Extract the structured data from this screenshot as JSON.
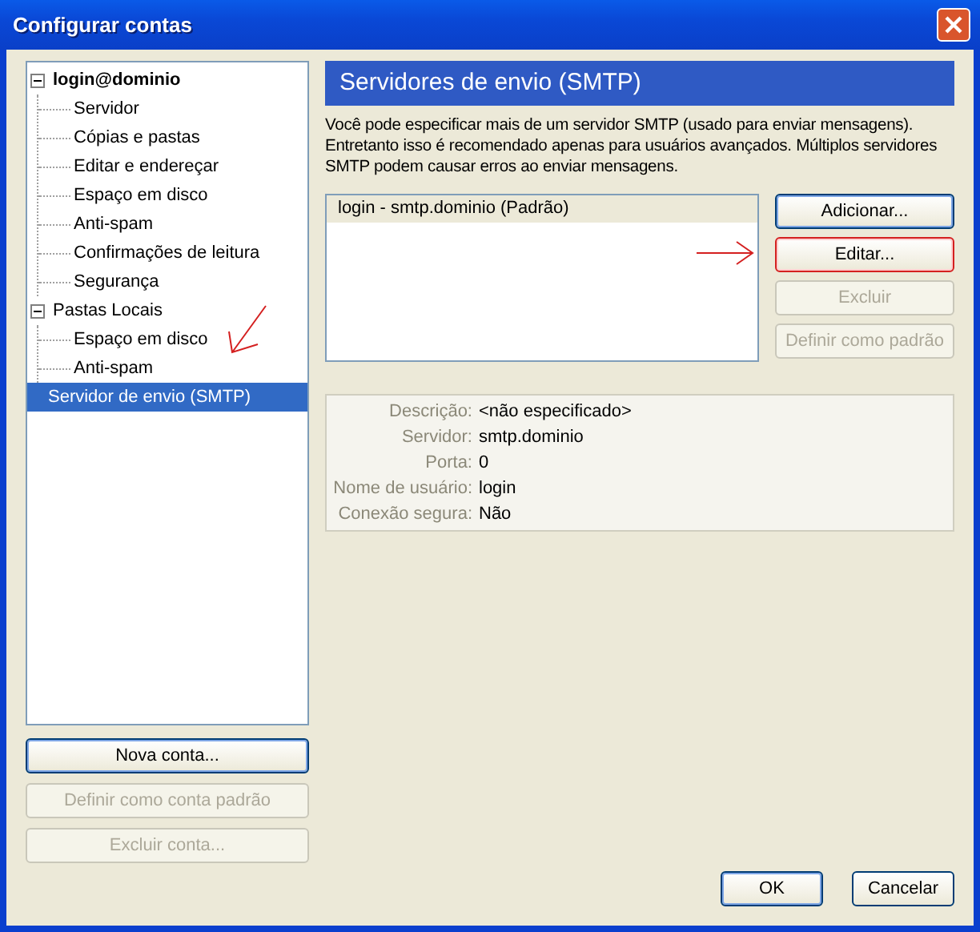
{
  "window": {
    "title": "Configurar contas"
  },
  "tree": [
    {
      "label": "login@dominio",
      "bold": true,
      "expanded": true,
      "selected": false,
      "children": [
        {
          "label": "Servidor",
          "selected": false
        },
        {
          "label": "Cópias e pastas",
          "selected": false
        },
        {
          "label": "Editar e endereçar",
          "selected": false
        },
        {
          "label": "Espaço em disco",
          "selected": false
        },
        {
          "label": "Anti-spam",
          "selected": false
        },
        {
          "label": "Confirmações de leitura",
          "selected": false
        },
        {
          "label": "Segurança",
          "selected": false
        }
      ]
    },
    {
      "label": "Pastas Locais",
      "bold": false,
      "expanded": true,
      "selected": false,
      "children": [
        {
          "label": "Espaço em disco",
          "selected": false
        },
        {
          "label": "Anti-spam",
          "selected": false
        }
      ]
    },
    {
      "label": "Servidor de envio (SMTP)",
      "bold": false,
      "selected": true
    }
  ],
  "account_buttons": [
    {
      "label": "Nova conta...",
      "disabled": false,
      "default": true
    },
    {
      "label": "Definir como conta padrão",
      "disabled": true,
      "default": false
    },
    {
      "label": "Excluir conta...",
      "disabled": true,
      "default": false
    }
  ],
  "panel": {
    "title": "Servidores de envio (SMTP)",
    "description": "Você pode especificar mais de um servidor SMTP (usado para enviar mensagens). Entretanto isso é recomendado apenas para usuários avançados. Múltiplos servidores SMTP podem causar erros ao enviar mensagens.",
    "servers": [
      {
        "label": "login - smtp.dominio (Padrão)",
        "selected": true
      }
    ],
    "buttons": [
      {
        "label": "Adicionar...",
        "disabled": false,
        "highlighted": false
      },
      {
        "label": "Editar...",
        "disabled": false,
        "highlighted": true
      },
      {
        "label": "Excluir",
        "disabled": true,
        "highlighted": false
      },
      {
        "label": "Definir como padrão",
        "disabled": true,
        "highlighted": false
      }
    ],
    "details": [
      {
        "label": "Descrição:",
        "value": "<não especificado>"
      },
      {
        "label": "Servidor:",
        "value": "smtp.dominio"
      },
      {
        "label": "Porta:",
        "value": "0"
      },
      {
        "label": "Nome de usuário:",
        "value": "login"
      },
      {
        "label": "Conexão segura:",
        "value": "Não"
      }
    ]
  },
  "dialog_buttons": [
    {
      "label": "OK",
      "default": true
    },
    {
      "label": "Cancelar",
      "default": false
    }
  ]
}
